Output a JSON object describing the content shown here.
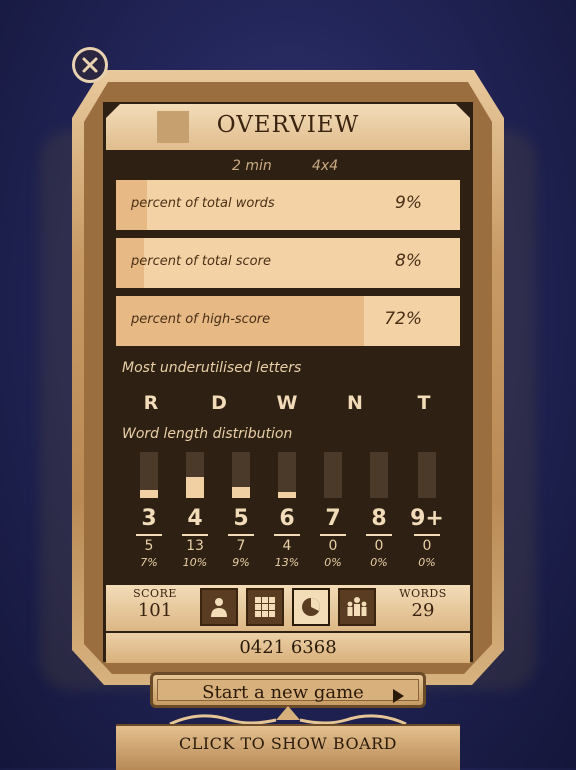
{
  "overview": {
    "title": "OVERVIEW",
    "duration": "2 min",
    "board_size": "4x4"
  },
  "stats_bars": [
    {
      "label": "percent of total words",
      "value": "9%",
      "fraction": 0.09
    },
    {
      "label": "percent of total score",
      "value": "8%",
      "fraction": 0.08
    },
    {
      "label": "percent of high-score",
      "value": "72%",
      "fraction": 0.72
    }
  ],
  "underutilised": {
    "heading": "Most underutilised letters",
    "letters": [
      "R",
      "D",
      "W",
      "N",
      "T"
    ]
  },
  "distribution": {
    "heading": "Word length distribution",
    "columns": [
      {
        "length": "3",
        "count": "5",
        "pct": "7%",
        "fill": 0.18
      },
      {
        "length": "4",
        "count": "13",
        "pct": "10%",
        "fill": 0.45
      },
      {
        "length": "5",
        "count": "7",
        "pct": "9%",
        "fill": 0.24
      },
      {
        "length": "6",
        "count": "4",
        "pct": "13%",
        "fill": 0.14
      },
      {
        "length": "7",
        "count": "0",
        "pct": "0%",
        "fill": 0
      },
      {
        "length": "8",
        "count": "0",
        "pct": "0%",
        "fill": 0
      },
      {
        "length": "9+",
        "count": "0",
        "pct": "0%",
        "fill": 0
      }
    ]
  },
  "footer": {
    "score_label": "SCORE",
    "score_value": "101",
    "words_label": "WORDS",
    "words_value": "29",
    "tabs": [
      "person-icon",
      "grid-icon",
      "pie-chart-icon",
      "players-icon"
    ],
    "active_tab": "pie-chart-icon",
    "code": "0421 6368"
  },
  "actions": {
    "new_game": "Start a new game",
    "show_board": "CLICK TO SHOW BOARD"
  },
  "colors": {
    "panel": "#2e2013",
    "gold": "#e0bd8d",
    "bar_light": "#f3d3a6",
    "bar_fill": "#e6b985",
    "background": "#23265a"
  }
}
